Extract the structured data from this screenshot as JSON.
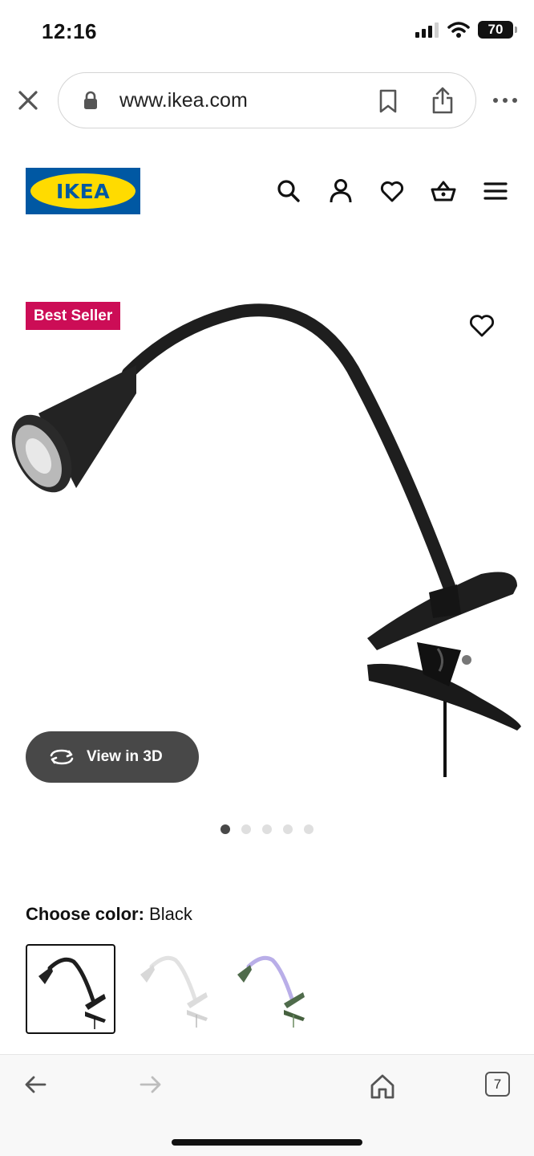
{
  "status_bar": {
    "time": "12:16",
    "battery": "70"
  },
  "browser": {
    "url": "www.ikea.com",
    "tab_count": "7"
  },
  "header": {
    "logo_text": "IKEA"
  },
  "product": {
    "badge": "Best Seller",
    "view_3d_label": "View in 3D",
    "image_count": 5,
    "active_image": 1,
    "color_label": "Choose color:",
    "selected_color": "Black",
    "color_options": [
      "Black",
      "White",
      "Green"
    ]
  },
  "colors": {
    "brand_blue": "#0058a3",
    "brand_yellow": "#ffdb00",
    "badge_red": "#cc0d56",
    "button_dark": "#484848"
  },
  "icons": [
    "close-icon",
    "lock-icon",
    "bookmark-icon",
    "share-icon",
    "more-icon",
    "search-icon",
    "account-icon",
    "heart-icon",
    "basket-icon",
    "menu-icon",
    "rotate-icon",
    "back-arrow-icon",
    "forward-arrow-icon",
    "home-icon"
  ]
}
